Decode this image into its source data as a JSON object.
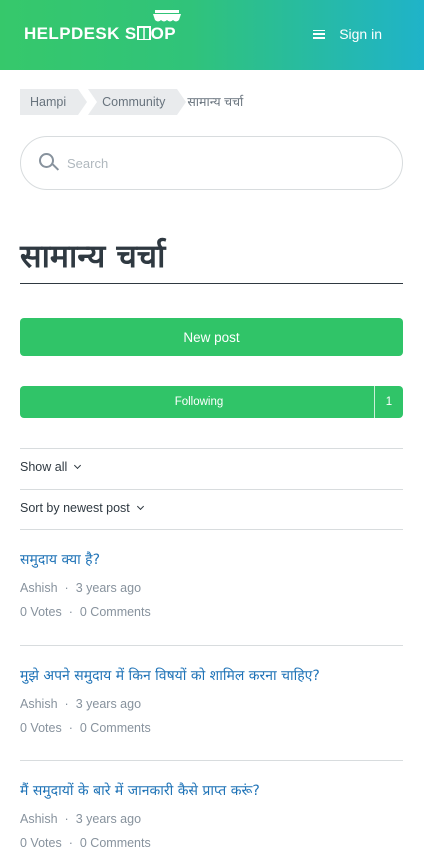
{
  "header": {
    "logo": {
      "part1": "HELPDESK S",
      "part2": "OP"
    },
    "menu_icon": "hamburger-menu-icon",
    "sign_in": "Sign in"
  },
  "breadcrumbs": [
    "Hampi",
    "Community",
    "सामान्य चर्चा"
  ],
  "search": {
    "placeholder": "Search",
    "icon": "search-icon"
  },
  "page_title": "सामान्य चर्चा",
  "buttons": {
    "new_post": "New post",
    "following": "Following",
    "follower_count": "1"
  },
  "filters": {
    "show": "Show all",
    "sort": "Sort by newest post"
  },
  "posts": [
    {
      "title": "समुदाय क्या है?",
      "author": "Ashish",
      "time": "3 years ago",
      "votes": "0 Votes",
      "comments": "0 Comments"
    },
    {
      "title": "मुझे अपने समुदाय में किन विषयों को शामिल करना चाहिए?",
      "author": "Ashish",
      "time": "3 years ago",
      "votes": "0 Votes",
      "comments": "0 Comments"
    },
    {
      "title": "मैं समुदायों के बारे में जानकारी कैसे प्राप्त करूं?",
      "author": "Ashish",
      "time": "3 years ago",
      "votes": "0 Votes",
      "comments": "0 Comments"
    }
  ],
  "colors": {
    "brand_green": "#30c468",
    "gradient_end": "#1fb3c9",
    "link_blue": "#1f73b7",
    "text_dark": "#2f3941",
    "muted": "#87929d"
  }
}
